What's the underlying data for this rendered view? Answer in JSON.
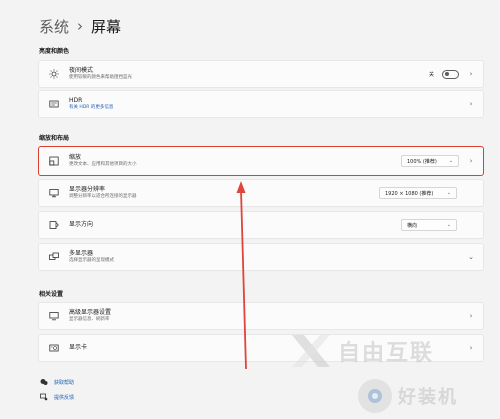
{
  "breadcrumb": {
    "parent": "系统",
    "separator": "›",
    "current": "屏幕"
  },
  "sections": {
    "brightness": "亮度和颜色",
    "scale_layout": "缩放和布局",
    "related": "相关设置"
  },
  "items": {
    "night_light": {
      "title": "夜间模式",
      "subtitle": "使用较暖的颜色来帮助阻挡蓝光",
      "toggle_label": "关",
      "icon": "sun-icon"
    },
    "hdr": {
      "title": "HDR",
      "subtitle": "有关 HDR 的更多信息",
      "icon": "hdr-icon"
    },
    "scale": {
      "title": "缩放",
      "subtitle": "更改文本、应用和其他项目的大小",
      "value": "100% (推荐)",
      "icon": "scale-icon"
    },
    "resolution": {
      "title": "显示器分辨率",
      "subtitle": "调整分辨率以适合所连接的显示器",
      "value": "1920 × 1080 (推荐)",
      "icon": "resolution-icon"
    },
    "orientation": {
      "title": "显示方向",
      "value": "横向",
      "icon": "orientation-icon"
    },
    "multi_display": {
      "title": "多显示器",
      "subtitle": "选择显示器的呈现模式",
      "icon": "multi-display-icon"
    },
    "advanced": {
      "title": "高级显示器设置",
      "subtitle": "显示器信息、刷新率",
      "icon": "monitor-icon"
    },
    "graphics": {
      "title": "显示卡",
      "icon": "graphics-icon"
    }
  },
  "footer": {
    "help": "获取帮助",
    "feedback": "提供反馈"
  },
  "watermark": {
    "text1": "自由互联",
    "text2": "好装机"
  },
  "colors": {
    "highlight_border": "#d9412c",
    "arrow": "#e0443a",
    "link": "#1a5fb4"
  }
}
